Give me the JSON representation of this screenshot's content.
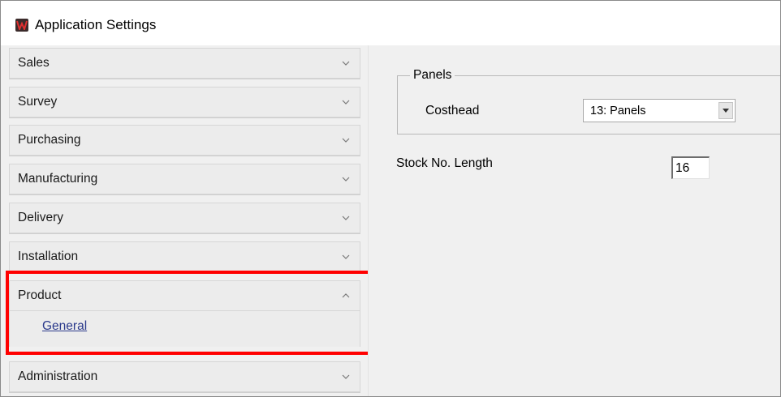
{
  "window": {
    "title": "Application Settings",
    "app_icon": "w-logo-icon"
  },
  "sidebar": {
    "sections": [
      {
        "label": "Sales",
        "expanded": false
      },
      {
        "label": "Survey",
        "expanded": false
      },
      {
        "label": "Purchasing",
        "expanded": false
      },
      {
        "label": "Manufacturing",
        "expanded": false
      },
      {
        "label": "Delivery",
        "expanded": false
      },
      {
        "label": "Installation",
        "expanded": false
      },
      {
        "label": "Product",
        "expanded": true,
        "items": [
          {
            "label": "General"
          }
        ]
      },
      {
        "label": "Administration",
        "expanded": false
      }
    ],
    "highlight_color": "#ff0000"
  },
  "content": {
    "panels_group": {
      "title": "Panels",
      "costhead_label": "Costhead",
      "costhead_value": "13: Panels"
    },
    "stock_no_length_label": "Stock No. Length",
    "stock_no_length_value": "16"
  }
}
